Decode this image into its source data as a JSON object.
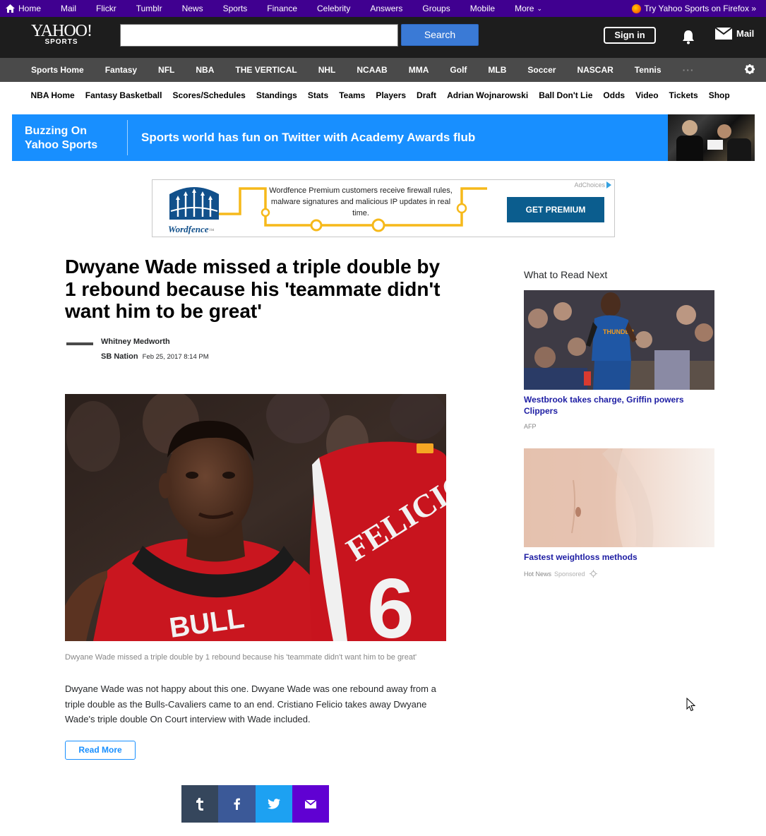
{
  "topbar": {
    "items": [
      "Home",
      "Mail",
      "Flickr",
      "Tumblr",
      "News",
      "Sports",
      "Finance",
      "Celebrity",
      "Answers",
      "Groups",
      "Mobile",
      "More"
    ],
    "firefox_promo": "Try Yahoo Sports on Firefox »"
  },
  "header": {
    "logo_text": "YAHOO!",
    "logo_sub": "SPORTS",
    "search_value": "",
    "search_button": "Search",
    "signin": "Sign in",
    "mail": "Mail"
  },
  "sports_nav": {
    "items": [
      "Sports Home",
      "Fantasy",
      "NFL",
      "NBA",
      "THE VERTICAL",
      "NHL",
      "NCAAB",
      "MMA",
      "Golf",
      "MLB",
      "Soccer",
      "NASCAR",
      "Tennis"
    ],
    "more_dots": "···"
  },
  "sub_nav": {
    "items": [
      "NBA Home",
      "Fantasy Basketball",
      "Scores/Schedules",
      "Standings",
      "Stats",
      "Teams",
      "Players",
      "Draft",
      "Adrian Wojnarowski",
      "Ball Don't Lie",
      "Odds",
      "Video",
      "Tickets",
      "Shop"
    ]
  },
  "buzzing": {
    "label_line1": "Buzzing On",
    "label_line2": "Yahoo Sports",
    "headline": "Sports world has fun on Twitter with Academy Awards flub"
  },
  "ad": {
    "adchoices": "AdChoices",
    "brand": "Wordfence",
    "text": "Wordfence Premium customers receive firewall rules, malware signatures and malicious IP updates in real time.",
    "cta": "GET PREMIUM"
  },
  "article": {
    "title": "Dwyane Wade missed a triple double by 1 rebound because his 'teammate didn't want him to be great'",
    "author": "Whitney Medworth",
    "source": "SB Nation",
    "date": "Feb 25, 2017 8:14 PM",
    "caption": "Dwyane Wade missed a triple double by 1 rebound because his 'teammate didn't want him to be great'",
    "body": "Dwyane Wade was not happy about this one. Dwyane Wade was one rebound away from a triple double as the Bulls-Cavaliers came to an end. Cristiano Felicio takes away Dwyane Wade's triple double On Court interview with Wade included.",
    "read_more": "Read More",
    "jersey_name": "FELICIO",
    "jersey_number": "6"
  },
  "sidebar": {
    "heading": "What to Read Next",
    "cards": [
      {
        "title": "Westbrook takes charge, Griffin powers Clippers",
        "source": "AFP"
      },
      {
        "title": "Fastest weightloss methods",
        "source": "Hot News",
        "sponsored": "Sponsored"
      }
    ]
  },
  "colors": {
    "topbar": "#400090",
    "header": "#1d1d1d",
    "sports_nav": "#4a4a4a",
    "buzz": "#188fff",
    "link": "#1d1da3",
    "share_tumblr": "#35465c",
    "share_facebook": "#3b5998",
    "share_twitter": "#1da1f2",
    "share_email": "#6001d2"
  }
}
